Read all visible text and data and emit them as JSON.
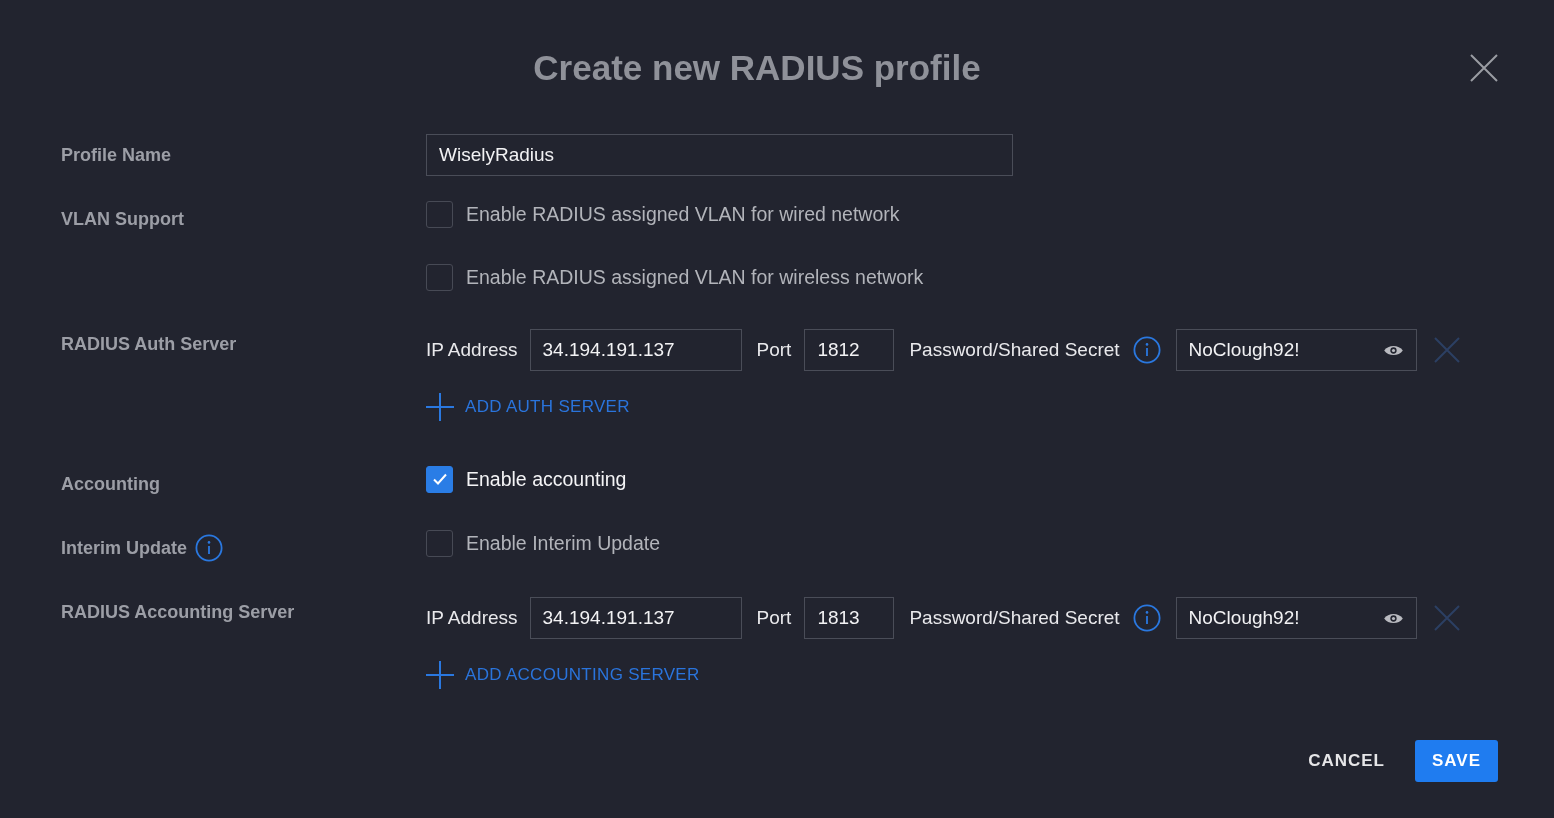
{
  "dialog": {
    "title": "Create new RADIUS profile"
  },
  "fields": [
    {
      "kind": "text",
      "label": "Profile Name",
      "info": false,
      "value": "WiselyRadius"
    },
    {
      "kind": "checkboxes",
      "label": "VLAN Support",
      "info": false,
      "options": [
        {
          "label": "Enable RADIUS assigned VLAN for wired network",
          "checked": false
        },
        {
          "label": "Enable RADIUS assigned VLAN for wireless network",
          "checked": false
        }
      ]
    },
    {
      "kind": "servers",
      "label": "RADIUS Auth Server",
      "info": false,
      "servers": [
        {
          "ip_label": "IP Address",
          "ip": "34.194.191.137",
          "port_label": "Port",
          "port": "1812",
          "secret_label": "Password/Shared Secret",
          "secret_info": true,
          "secret": "NoClough92!",
          "remove_disabled": true
        }
      ],
      "add_label": "ADD AUTH SERVER"
    },
    {
      "kind": "checkboxes",
      "label": "Accounting",
      "info": false,
      "options": [
        {
          "label": "Enable accounting",
          "checked": true
        }
      ]
    },
    {
      "kind": "checkboxes",
      "label": "Interim Update",
      "info": true,
      "options": [
        {
          "label": "Enable Interim Update",
          "checked": false
        }
      ]
    },
    {
      "kind": "servers",
      "label": "RADIUS Accounting Server",
      "info": false,
      "servers": [
        {
          "ip_label": "IP Address",
          "ip": "34.194.191.137",
          "port_label": "Port",
          "port": "1813",
          "secret_label": "Password/Shared Secret",
          "secret_info": true,
          "secret": "NoClough92!",
          "remove_disabled": true
        }
      ],
      "add_label": "ADD ACCOUNTING SERVER"
    }
  ],
  "buttons": [
    {
      "label": "CANCEL",
      "kind": "text"
    },
    {
      "label": "SAVE",
      "kind": "primary"
    }
  ]
}
